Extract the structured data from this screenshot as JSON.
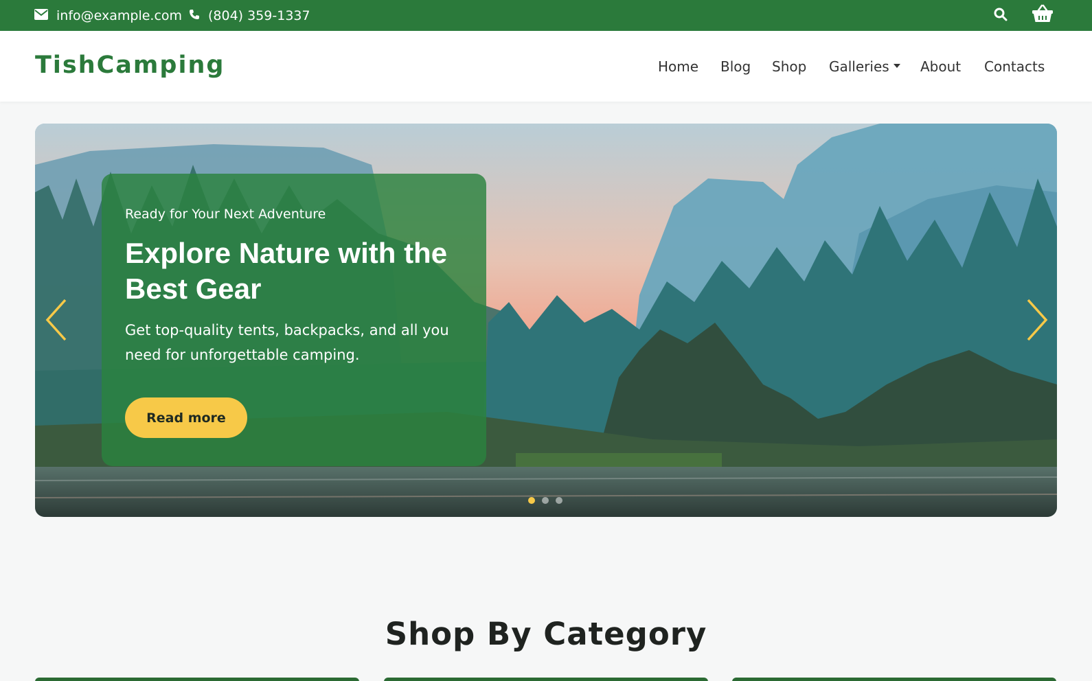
{
  "topbar": {
    "email": "info@example.com",
    "phone": "(804) 359-1337",
    "icons": [
      "envelope-icon",
      "phone-icon",
      "search-icon",
      "basket-icon"
    ]
  },
  "header": {
    "logo": "TishCamping",
    "nav": [
      {
        "label": "Home"
      },
      {
        "label": "Blog"
      },
      {
        "label": "Shop"
      },
      {
        "label": "Galleries",
        "dropdown": true
      },
      {
        "label": "About"
      },
      {
        "label": "Contacts"
      }
    ]
  },
  "hero": {
    "eyebrow": "Ready for Your Next Adventure",
    "headline": "Explore Nature with the Best Gear",
    "description": "Get top-quality tents, backpacks, and all you need for unforgettable camping.",
    "button_label": "Read more",
    "slides_total": 3,
    "active_slide": 1
  },
  "section": {
    "title": "Shop By Category"
  },
  "colors": {
    "primary_green": "#2b7a3b",
    "accent_yellow": "#f7c948",
    "card_green": "#2b823e"
  }
}
